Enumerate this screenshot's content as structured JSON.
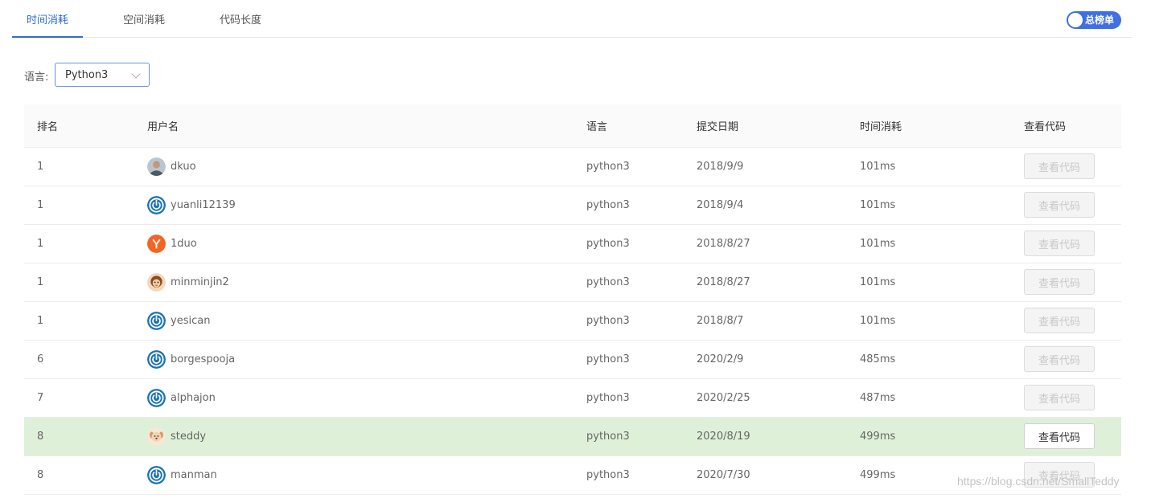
{
  "tabs": [
    {
      "label": "时间消耗",
      "active": true
    },
    {
      "label": "空间消耗",
      "active": false
    },
    {
      "label": "代码长度",
      "active": false
    }
  ],
  "toggle": {
    "label": "总榜单",
    "on": true
  },
  "filter": {
    "label": "语言:",
    "value": "Python3"
  },
  "table": {
    "headers": [
      "排名",
      "用户名",
      "语言",
      "提交日期",
      "时间消耗",
      "查看代码"
    ],
    "rows": [
      {
        "rank": "1",
        "user": "dkuo",
        "avatar": "photo-male",
        "lang": "python3",
        "date": "2018/9/9",
        "time": "101ms",
        "button": "查看代码",
        "enabled": false,
        "highlight": false
      },
      {
        "rank": "1",
        "user": "yuanli12139",
        "avatar": "power-icon",
        "lang": "python3",
        "date": "2018/9/4",
        "time": "101ms",
        "button": "查看代码",
        "enabled": false,
        "highlight": false
      },
      {
        "rank": "1",
        "user": "1duo",
        "avatar": "letter-y",
        "lang": "python3",
        "date": "2018/8/27",
        "time": "101ms",
        "button": "查看代码",
        "enabled": false,
        "highlight": false
      },
      {
        "rank": "1",
        "user": "minminjin2",
        "avatar": "cartoon-monkey",
        "lang": "python3",
        "date": "2018/8/27",
        "time": "101ms",
        "button": "查看代码",
        "enabled": false,
        "highlight": false
      },
      {
        "rank": "1",
        "user": "yesican",
        "avatar": "power-icon",
        "lang": "python3",
        "date": "2018/8/7",
        "time": "101ms",
        "button": "查看代码",
        "enabled": false,
        "highlight": false
      },
      {
        "rank": "6",
        "user": "borgespooja",
        "avatar": "power-icon",
        "lang": "python3",
        "date": "2020/2/9",
        "time": "485ms",
        "button": "查看代码",
        "enabled": false,
        "highlight": false
      },
      {
        "rank": "7",
        "user": "alphajon",
        "avatar": "power-icon",
        "lang": "python3",
        "date": "2020/2/25",
        "time": "487ms",
        "button": "查看代码",
        "enabled": false,
        "highlight": false
      },
      {
        "rank": "8",
        "user": "steddy",
        "avatar": "cartoon-dog",
        "lang": "python3",
        "date": "2020/8/19",
        "time": "499ms",
        "button": "查看代码",
        "enabled": true,
        "highlight": true
      },
      {
        "rank": "8",
        "user": "manman",
        "avatar": "power-icon",
        "lang": "python3",
        "date": "2020/7/30",
        "time": "499ms",
        "button": "查看代码",
        "enabled": false,
        "highlight": false
      }
    ]
  },
  "watermark": "https://blog.csdn.net/SmallTeddy",
  "colors": {
    "accent": "#2e6bd9",
    "toggle": "#3f6fe0",
    "highlight_row": "#dff0d8",
    "power_icon": "#1a73b8",
    "letter_avatar": "#f26522"
  }
}
